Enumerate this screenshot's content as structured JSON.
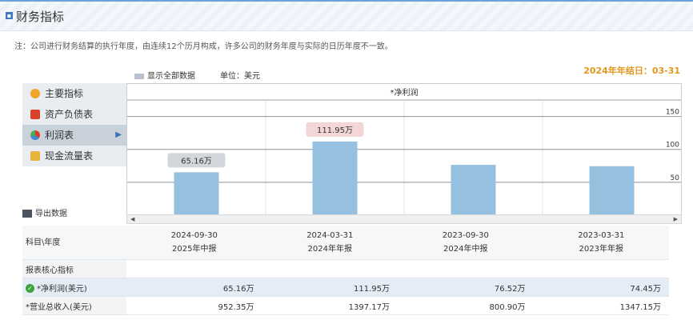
{
  "header": {
    "title": "财务指标"
  },
  "note": "注：公司进行财务结算的执行年度，由连续12个历月构成，许多公司的财务年度与实际的日历年度不一致。",
  "fiscal_year_end": "2024年年结日：03-31",
  "toolbar": {
    "show_all": "显示全部数据",
    "unit": "单位：美元"
  },
  "sidebar": {
    "items": [
      {
        "label": "主要指标",
        "icon": "sun-icon"
      },
      {
        "label": "资产负债表",
        "icon": "document-icon"
      },
      {
        "label": "利润表",
        "icon": "pie-chart-icon"
      },
      {
        "label": "现金流量表",
        "icon": "coins-icon"
      }
    ],
    "arrow": "▶"
  },
  "export_label": "导出数据",
  "chart_data": {
    "type": "bar",
    "title": "*净利润",
    "categories": [
      "2024-09-30",
      "2024-03-31",
      "2023-09-30",
      "2023-03-31"
    ],
    "values": [
      65.16,
      111.95,
      76.52,
      74.45
    ],
    "data_labels": [
      "65.16万",
      "111.95万",
      "",
      ""
    ],
    "yticks": [
      50,
      100,
      150
    ],
    "ylim": [
      0,
      175
    ],
    "bar_color": "#96c0e0"
  },
  "table": {
    "header_label": "科目\\年度",
    "columns": [
      {
        "date": "2024-09-30",
        "period": "2025年中报"
      },
      {
        "date": "2024-03-31",
        "period": "2024年年报"
      },
      {
        "date": "2023-09-30",
        "period": "2024年中报"
      },
      {
        "date": "2023-03-31",
        "period": "2023年年报"
      }
    ],
    "section": "报表核心指标",
    "rows": [
      {
        "label": "*净利润(美元)",
        "values": [
          "65.16万",
          "111.95万",
          "76.52万",
          "74.45万"
        ]
      },
      {
        "label": "*营业总收入(美元)",
        "values": [
          "952.35万",
          "1397.17万",
          "800.90万",
          "1347.15万"
        ]
      }
    ]
  }
}
